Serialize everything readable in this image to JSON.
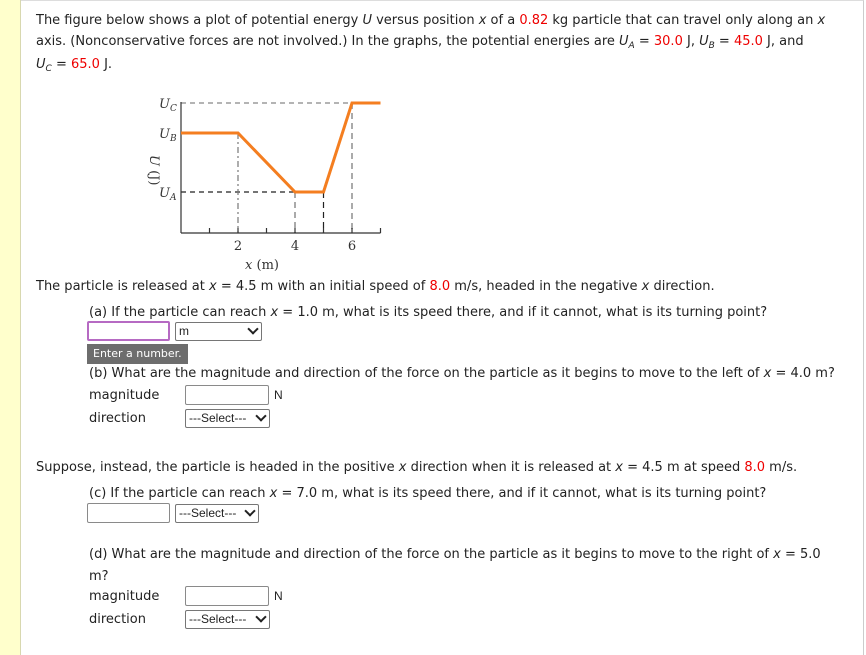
{
  "intro": {
    "line1_a": "The figure below shows a plot of potential energy ",
    "U": "U",
    "line1_b": " versus position ",
    "x": "x",
    "line1_c": " of a ",
    "mass": "0.82",
    "line1_d": " kg particle that can travel only along an ",
    "line2_a": "axis. (Nonconservative forces are not involved.) In the graphs, the potential energies are ",
    "UA_sub": "A",
    "UA_val": "30.0",
    "UB_sub": "B",
    "UB_val": "45.0",
    "UC_sub": "C",
    "UC_val": "65.0",
    "eq": " = ",
    "unit_J": " J",
    "comma": ", ",
    "and": ", and"
  },
  "graph": {
    "y_axis_label": "U (J)",
    "x_axis_label": "x (m)",
    "level_labels": [
      "U_C",
      "U_B",
      "U_A"
    ],
    "x_ticks": [
      "2",
      "4",
      "6"
    ],
    "curve_color": "#f47e20",
    "levels": {
      "UA": 30.0,
      "UB": 45.0,
      "UC": 65.0
    },
    "points": [
      {
        "x": 0,
        "level": "UB"
      },
      {
        "x": 2,
        "level": "UB"
      },
      {
        "x": 4,
        "level": "UA"
      },
      {
        "x": 5,
        "level": "UA"
      },
      {
        "x": 6,
        "level": "UC"
      },
      {
        "x": 7,
        "level": "UC"
      }
    ]
  },
  "release1": {
    "text_a": "The particle is released at ",
    "text_b": " = 4.5 m with an initial speed of ",
    "speed": "8.0",
    "text_c": " m/s, headed in the negative ",
    "text_d": " direction."
  },
  "part_a": {
    "q_a": "(a) If the particle can reach ",
    "q_b": " = 1.0 m, what is its speed there, and if it cannot, what is its turning point?",
    "input_value": "",
    "unit_select": "m",
    "tooltip": "Enter a number."
  },
  "part_b": {
    "q_a": "(b) What are the magnitude and direction of the force on the particle as it begins to move to the left of ",
    "q_b": " = 4.0 m?",
    "magnitude_label": "magnitude",
    "magnitude_value": "",
    "unit": "N",
    "direction_label": "direction",
    "direction_select": "---Select---"
  },
  "release2": {
    "text_a": "Suppose, instead, the particle is headed in the positive ",
    "text_b": " direction when it is released at ",
    "text_c": " = 4.5 m at speed ",
    "speed": "8.0",
    "text_d": " m/s."
  },
  "part_c": {
    "q_a": "(c) If the particle can reach ",
    "q_b": " = 7.0 m, what is its speed there, and if it cannot, what is its turning point?",
    "input_value": "",
    "unit_select": "---Select---"
  },
  "part_d": {
    "q_a": "(d) What are the magnitude and direction of the force on the particle as it begins to move to the right of ",
    "q_b": " = 5.0",
    "q_c": "m?",
    "magnitude_label": "magnitude",
    "magnitude_value": "",
    "unit": "N",
    "direction_label": "direction",
    "direction_select": "---Select---"
  }
}
